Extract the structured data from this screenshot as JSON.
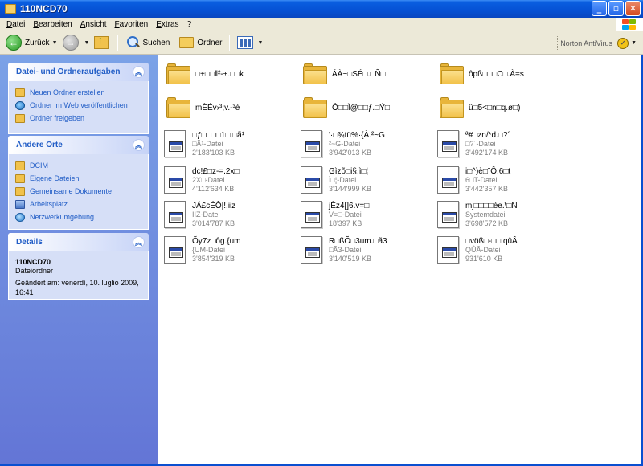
{
  "window": {
    "title": "110NCD70"
  },
  "menu": [
    "Datei",
    "Bearbeiten",
    "Ansicht",
    "Favoriten",
    "Extras",
    "?"
  ],
  "toolbar": {
    "back_label": "Zurück",
    "search_label": "Suchen",
    "folders_label": "Ordner",
    "norton_label": "Norton AntiVirus"
  },
  "tasks_panel": {
    "title": "Datei- und Ordneraufgaben",
    "items": [
      {
        "label": "Neuen Ordner erstellen",
        "icon": "new-folder-icon"
      },
      {
        "label": "Ordner im Web veröffentlichen",
        "icon": "publish-web-icon"
      },
      {
        "label": "Ordner freigeben",
        "icon": "share-folder-icon"
      }
    ]
  },
  "places_panel": {
    "title": "Andere Orte",
    "items": [
      {
        "label": "DCIM",
        "icon": "folder-icon"
      },
      {
        "label": "Eigene Dateien",
        "icon": "folder-icon"
      },
      {
        "label": "Gemeinsame Dokumente",
        "icon": "folder-icon"
      },
      {
        "label": "Arbeitsplatz",
        "icon": "my-computer-icon"
      },
      {
        "label": "Netzwerkumgebung",
        "icon": "network-icon"
      }
    ]
  },
  "details_panel": {
    "title": "Details",
    "name": "110NCD70",
    "type": "Dateiordner",
    "modified": "Geändert am: venerdì, 10. luglio 2009, 16:41"
  },
  "folders": [
    "□+□□‖²-±.□□k",
    "ÁÀ~□SÉ□.□Ñ□",
    "ôpß□□□C□.À=s",
    "mÈÉv›³;v.-³è",
    "Ó□□Ï@□□ƒ.□Ý□",
    "ü□5<□n□q.ø□)"
  ],
  "files": [
    {
      "name": "□ƒ□□□□1□.□ã¹",
      "type": "□Ã¹-Datei",
      "size": "2'183'103 KB"
    },
    {
      "name": "'·□¾tü%·{À.²~G",
      "type": "²~G-Datei",
      "size": "3'942'013 KB"
    },
    {
      "name": "ª#□zn/*d.□?´",
      "type": "□?´-Datei",
      "size": "3'492'174 KB"
    },
    {
      "name": "dc!£□z-=.2x□",
      "type": "2X□-Datei",
      "size": "4'112'634 KB"
    },
    {
      "name": "Gìzõ□i§.ì□¦",
      "type": "Ì□¦-Datei",
      "size": "3'144'999 KB"
    },
    {
      "name": "i□^)è□¨Ô.6□t",
      "type": "6□T-Datei",
      "size": "3'442'357 KB"
    },
    {
      "name": "JÁ£cÉÔ|!.iiz",
      "type": "IÍZ-Datei",
      "size": "3'014'787 KB"
    },
    {
      "name": "jÈz4[]6.v=□",
      "type": "V=□-Datei",
      "size": "18'397 KB"
    },
    {
      "name": "mj□□□□ée.\\□N",
      "type": "Systemdatei",
      "size": "3'698'572 KB"
    },
    {
      "name": "Õy7z□ôg.{um",
      "type": "{UM-Datei",
      "size": "3'854'319 KB"
    },
    {
      "name": "R□ßÕ□3um.□ã3",
      "type": "□Ã3-Datei",
      "size": "3'140'519 KB"
    },
    {
      "name": "□vöß□-□□.qûÂ",
      "type": "QÛÂ-Datei",
      "size": "931'610 KB"
    }
  ]
}
